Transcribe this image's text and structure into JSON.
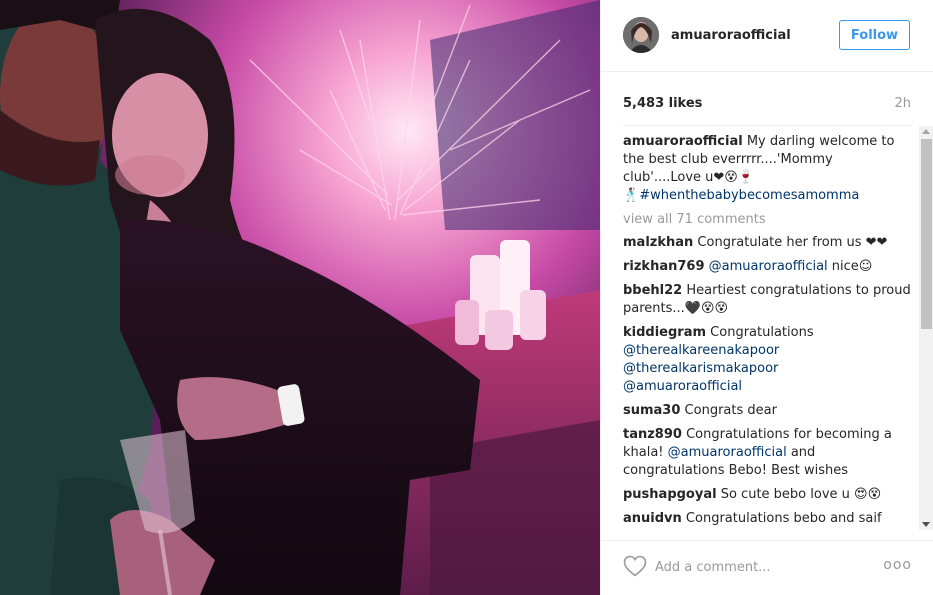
{
  "post": {
    "owner": "amuaroraofficial",
    "follow_label": "Follow",
    "likes": "5,483 likes",
    "time": "2h",
    "caption": {
      "user": "amuaroraofficial",
      "text": "My darling welcome to the best club everrrrr....'Mommy club'....Love u❤😵🍷",
      "line2_emoji": "🕺🏽",
      "hashtag": "#whenthebabybecomesamomma"
    },
    "view_all": "view all 71 comments",
    "comments": [
      {
        "user": "malzkhan",
        "text": "Congratulate her from us ❤❤"
      },
      {
        "user": "rizkhan769",
        "mention": "@amuaroraofficial",
        "text": " nice☺"
      },
      {
        "user": "bbehl22",
        "text": "Heartiest congratulations to proud parents...🖤😵😵"
      },
      {
        "user": "kiddiegram",
        "text": "Congratulations",
        "mentions": [
          "@therealkareenakapoor",
          "@therealkarismakapoor",
          "@amuaroraofficial"
        ]
      },
      {
        "user": "suma30",
        "text": "Congrats dear"
      },
      {
        "user": "tanz890",
        "text_before": "Congratulations for becoming a khala! ",
        "mention": "@amuaroraofficial",
        "text_after": " and congratulations Bebo! Best wishes"
      },
      {
        "user": "pushapgoyal",
        "text": "So cute bebo love u 😍😵"
      },
      {
        "user": "anuidvn",
        "text": "Congratulations bebo and saif"
      }
    ],
    "add_comment_placeholder": "Add a comment...",
    "more_label": "ooo",
    "icons": {
      "like": "heart-icon",
      "more": "more-options-icon"
    },
    "colors": {
      "link": "#003569",
      "follow": "#3897f0",
      "muted": "#999999"
    }
  }
}
